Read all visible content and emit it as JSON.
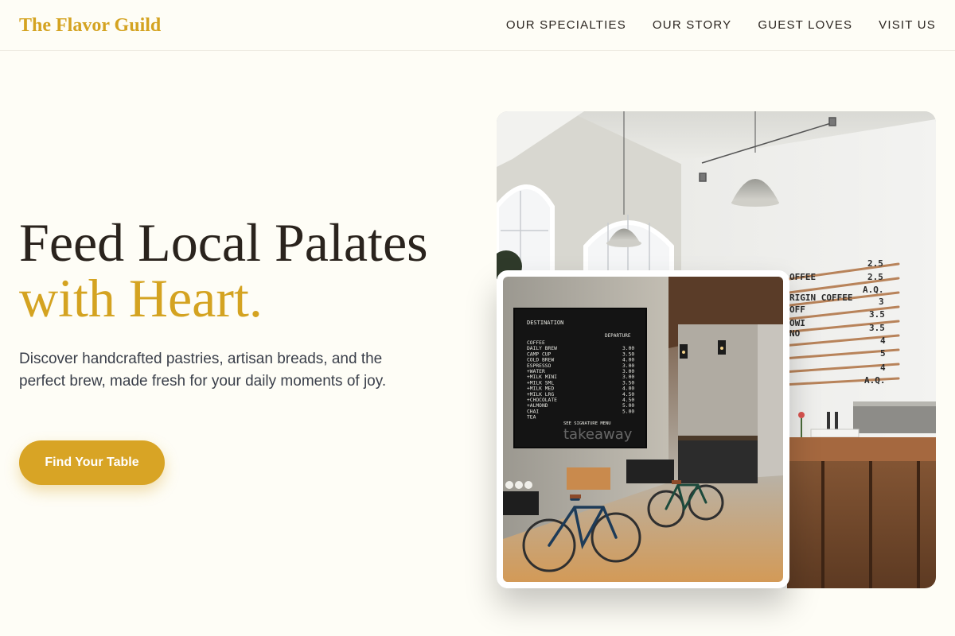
{
  "nav": {
    "brand": "The Flavor Guild",
    "links": [
      {
        "label": "OUR SPECIALTIES"
      },
      {
        "label": "OUR STORY"
      },
      {
        "label": "GUEST LOVES"
      },
      {
        "label": "VISIT US"
      }
    ]
  },
  "hero": {
    "title_line1": "Feed Local Palates",
    "title_line2": "with Heart.",
    "description": "Discover handcrafted pastries, artisan breads, and the perfect brew, made fresh for your daily moments of joy.",
    "cta_label": "Find Your Table"
  },
  "colors": {
    "accent": "#d4a321",
    "background": "#fefdf6",
    "text_dark": "#2a231d"
  },
  "images": {
    "main": {
      "alt": "Bright cafe interior with pendant lamps, arched windows and a wooden coffee menu board"
    },
    "inset": {
      "alt": "Cafe with a black departure-style menu board and two bicycles parked against a concrete wall"
    }
  },
  "menu_board": {
    "header_left": "DESTINATION",
    "header_right": "DEPARTURE",
    "rows": [
      {
        "item": "COFFEE",
        "price": ""
      },
      {
        "item": " DAILY BREW",
        "price": "3.00"
      },
      {
        "item": " CAMP CUP",
        "price": "3.50"
      },
      {
        "item": " COLD BREW",
        "price": "4.00"
      },
      {
        "item": "ESPRESSO",
        "price": "3.00"
      },
      {
        "item": " +WATER",
        "price": "3.00"
      },
      {
        "item": " +MILK MINI",
        "price": "3.00"
      },
      {
        "item": " +MILK SML",
        "price": "3.50"
      },
      {
        "item": " +MILK MED",
        "price": "4.00"
      },
      {
        "item": " +MILK LRG",
        "price": "4.50"
      },
      {
        "item": " +CHOCOLATE",
        "price": "4.50"
      },
      {
        "item": " +ALMOND",
        "price": "5.00"
      },
      {
        "item": "CHAI",
        "price": "5.00"
      },
      {
        "item": "TEA",
        "price": ""
      }
    ],
    "footer": "SEE SIGNATURE MENU",
    "watermark": "takeaway"
  },
  "wall_menu": {
    "rows": [
      {
        "item": "",
        "price": "2.5"
      },
      {
        "item": "OFFEE",
        "price": "2.5"
      },
      {
        "item": "RIGIN COFFEE",
        "price": "A.Q."
      },
      {
        "item": "",
        "price": "3"
      },
      {
        "item": "OFF",
        "price": "3.5"
      },
      {
        "item": "OWI",
        "price": "3.5"
      },
      {
        "item": "NO",
        "price": "4"
      },
      {
        "item": "",
        "price": "5"
      },
      {
        "item": "",
        "price": "4"
      },
      {
        "item": "",
        "price": "A.Q."
      }
    ]
  }
}
